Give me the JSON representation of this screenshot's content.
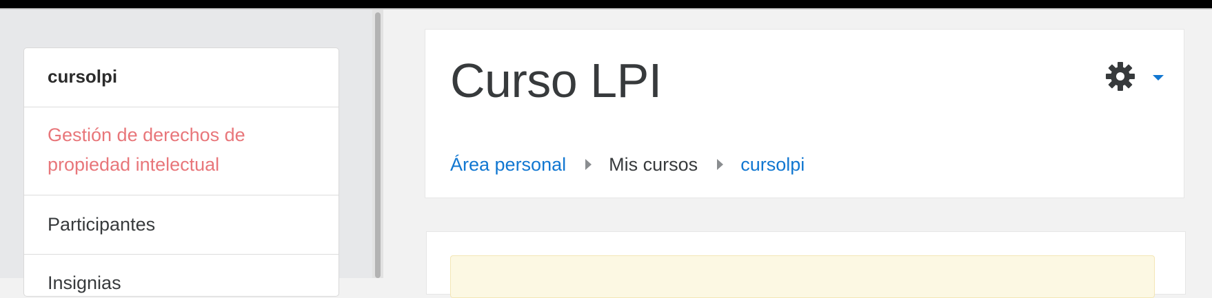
{
  "sidebar": {
    "course_shortname": "cursolpi",
    "items": [
      {
        "label": "Gestión de derechos de propiedad intelectual",
        "line1": "Gestión de derechos de",
        "line2": "propiedad intelectual",
        "active": true
      },
      {
        "label": "Participantes"
      },
      {
        "label": "Insignias"
      }
    ]
  },
  "header": {
    "title": "Curso LPI",
    "settings_icon": "gear-icon",
    "breadcrumb": [
      {
        "label": "Área personal",
        "link": true
      },
      {
        "label": "Mis cursos",
        "link": false
      },
      {
        "label": "cursolpi",
        "link": true
      }
    ]
  },
  "colors": {
    "accent": "#1177d1",
    "active_nav": "#e8767a",
    "notice_bg": "#fcf8e3"
  }
}
